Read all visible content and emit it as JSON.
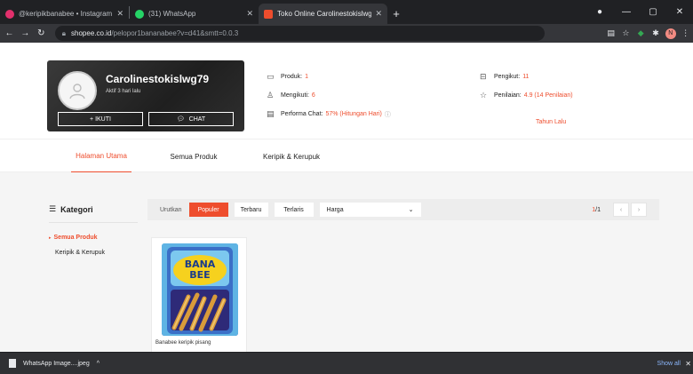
{
  "browser": {
    "tabs": [
      {
        "title": "@keripikbanabee • Instagram pl",
        "favicon_color": "#e1306c",
        "active": false
      },
      {
        "title": "(31) WhatsApp",
        "favicon_color": "#25d366",
        "active": false
      },
      {
        "title": "Toko Online Carolinestokislwg79",
        "favicon_color": "#ee4d2d",
        "active": true
      }
    ],
    "url_host": "shopee.co.id",
    "url_path": "/pelopor1bananabee?v=d41&smtt=0.0.3"
  },
  "shop": {
    "name": "Carolinestokislwg79",
    "active_status": "Aktif 3 hari lalu",
    "follow_label": "+ IKUTI",
    "chat_label": "CHAT",
    "stats": {
      "products_label": "Produk:",
      "products_value": "1",
      "following_label": "Mengikuti:",
      "following_value": "6",
      "chat_perf_label": "Performa Chat:",
      "chat_perf_value": "57% (Hitungan Hari)",
      "followers_label": "Pengikut:",
      "followers_value": "11",
      "rating_label": "Penilaian:",
      "rating_value": "4.9 (14 Penilaian)",
      "joined_value": "Tahun Lalu"
    }
  },
  "nav": {
    "tabs": [
      "Halaman Utama",
      "Semua Produk",
      "Keripik & Kerupuk"
    ],
    "active_index": 0
  },
  "category": {
    "title": "Kategori",
    "items": [
      "Semua Produk",
      "Keripik & Kerupuk"
    ],
    "active_index": 0
  },
  "sort": {
    "label": "Urutkan",
    "buttons": [
      "Populer",
      "Terbaru",
      "Terlaris"
    ],
    "active_index": 0,
    "price_label": "Harga",
    "page_current": "1",
    "page_total": "/1"
  },
  "product": {
    "name": "Banabee keripik pisang",
    "image_text": "BANA BEE"
  },
  "downloads": {
    "file": "WhatsApp Image....jpeg",
    "show_all": "Show all"
  },
  "colors": {
    "brand": "#ee4d2d",
    "chrome_dark": "#202124",
    "chrome_toolbar": "#35363a"
  }
}
